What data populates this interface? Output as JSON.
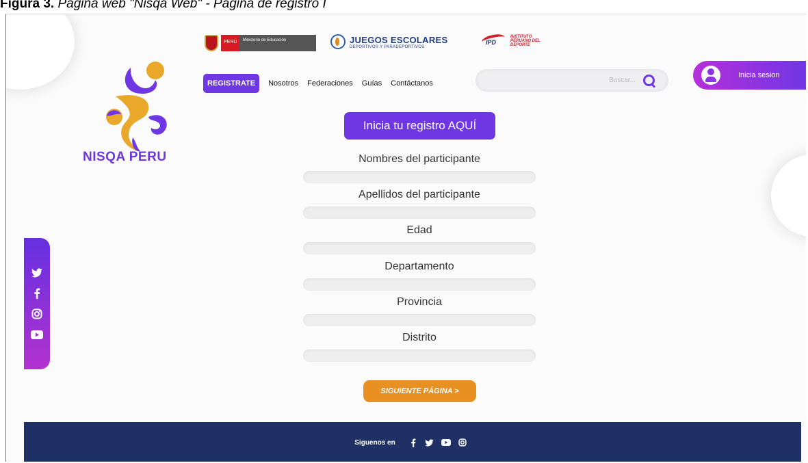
{
  "caption": {
    "label": "Figura 3.",
    "text": " Página web \"Nisqa Web\" - Página de registro I"
  },
  "brand": {
    "name": "NISQA PERU",
    "colors": {
      "primary": "#6f36e4",
      "accent": "#e99023",
      "footer": "#1f3064"
    }
  },
  "partners": {
    "minedu": {
      "country": "PERÚ",
      "ministry": "Ministerio de Educación"
    },
    "juegos": {
      "title": "JUEGOS ESCOLARES",
      "subtitle": "DEPORTIVOS Y PARADEPORTIVOS"
    },
    "ipd": {
      "acronym": "IPD",
      "name": "INSTITUTO PERUANO DEL DEPORTE"
    }
  },
  "nav": {
    "register": "REGISTRATE",
    "items": [
      "Nosotros",
      "Federaciones",
      "Guías",
      "Contáctanos"
    ]
  },
  "search": {
    "placeholder": "Buscar..."
  },
  "login": {
    "label": "Inicia sesion"
  },
  "form": {
    "cta": "Inicia tu registro AQUÍ",
    "fields": [
      {
        "label": "Nombres del participante",
        "value": ""
      },
      {
        "label": "Apellidos del participante",
        "value": ""
      },
      {
        "label": "Edad",
        "value": ""
      },
      {
        "label": "Departamento",
        "value": ""
      },
      {
        "label": "Provincia",
        "value": ""
      },
      {
        "label": "Distrito",
        "value": ""
      }
    ],
    "next": "SIGUIENTE PÁGINA >"
  },
  "social_sidebar": [
    "twitter-icon",
    "facebook-icon",
    "instagram-icon",
    "youtube-icon"
  ],
  "footer": {
    "label": "Siguenos en",
    "icons": [
      "facebook-icon",
      "twitter-icon",
      "youtube-icon",
      "instagram-icon"
    ]
  }
}
